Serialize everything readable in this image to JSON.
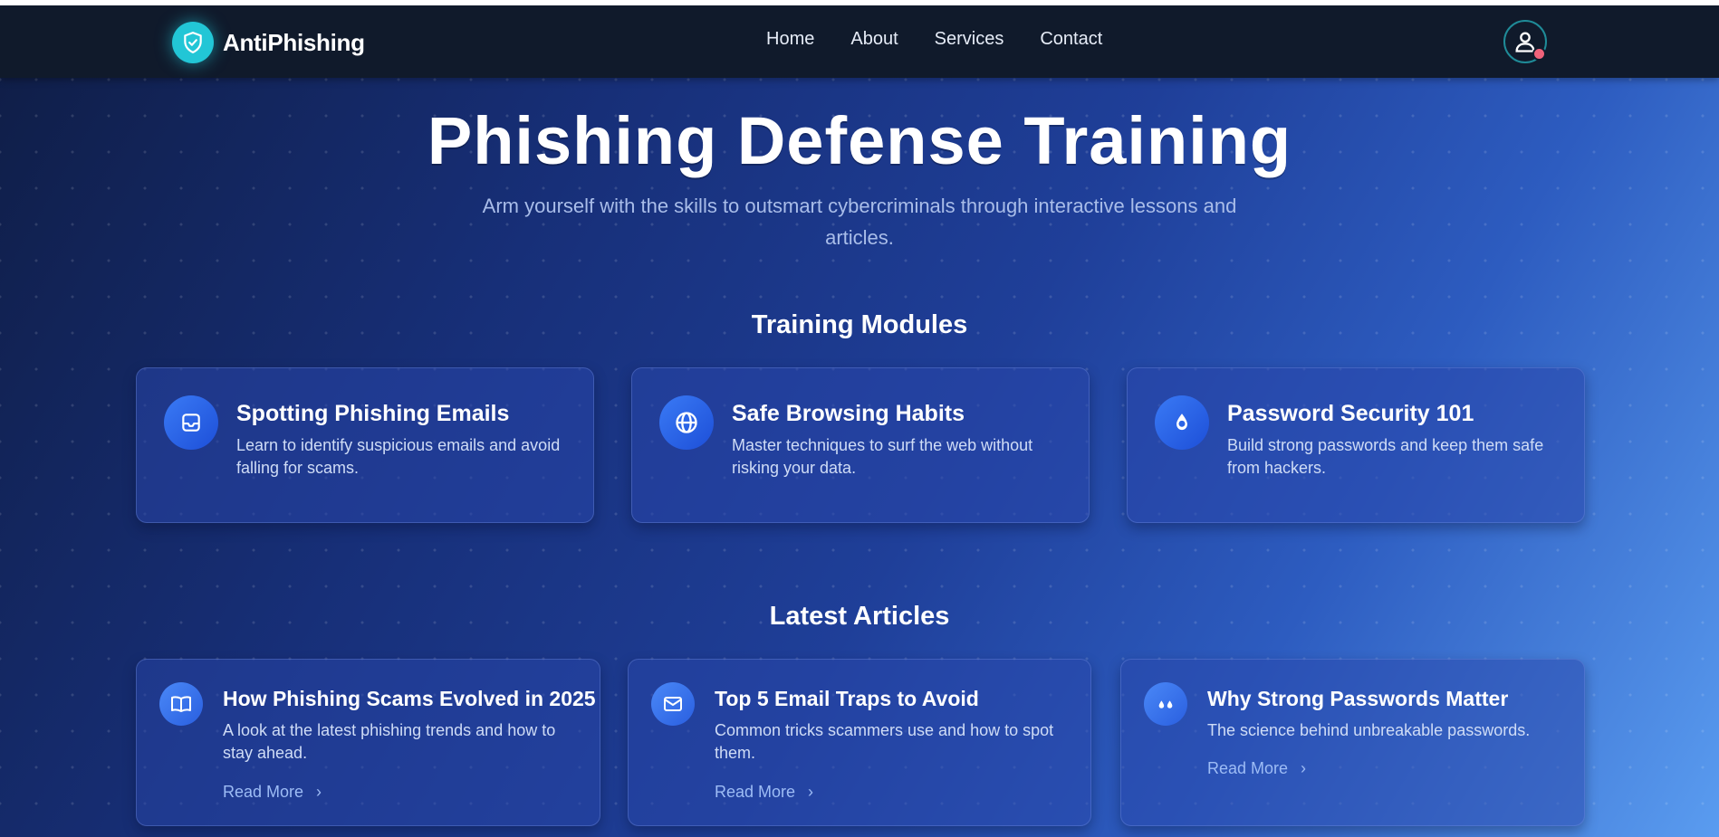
{
  "nav": {
    "brand": "AntiPhishing",
    "links": [
      "Home",
      "About",
      "Services",
      "Contact"
    ]
  },
  "hero": {
    "title": "Phishing Defense Training",
    "subtitle": "Arm yourself with the skills to outsmart cybercriminals through interactive lessons and articles."
  },
  "modules": {
    "heading": "Training Modules",
    "items": [
      {
        "icon": "inbox-icon",
        "title": "Spotting Phishing Emails",
        "desc": "Learn to identify suspicious emails and avoid falling for scams."
      },
      {
        "icon": "globe-icon",
        "title": "Safe Browsing Habits",
        "desc": "Master techniques to surf the web without risking your data."
      },
      {
        "icon": "key-icon",
        "title": "Password Security 101",
        "desc": "Build strong passwords and keep them safe from hackers."
      }
    ]
  },
  "articles": {
    "heading": "Latest Articles",
    "read_more": "Read More",
    "items": [
      {
        "icon": "book-open-icon",
        "title": "How Phishing Scams Evolved in 2025",
        "desc": "A look at the latest phishing trends and how to stay ahead."
      },
      {
        "icon": "envelope-icon",
        "title": "Top 5 Email Traps to Avoid",
        "desc": "Common tricks scammers use and how to spot them."
      },
      {
        "icon": "key-icon",
        "title": "Why Strong Passwords Matter",
        "desc": "The science behind unbreakable passwords."
      }
    ]
  },
  "colors": {
    "accent": "#22c6d6",
    "nav_bg": "#101a2b",
    "notification": "#f0627a"
  }
}
